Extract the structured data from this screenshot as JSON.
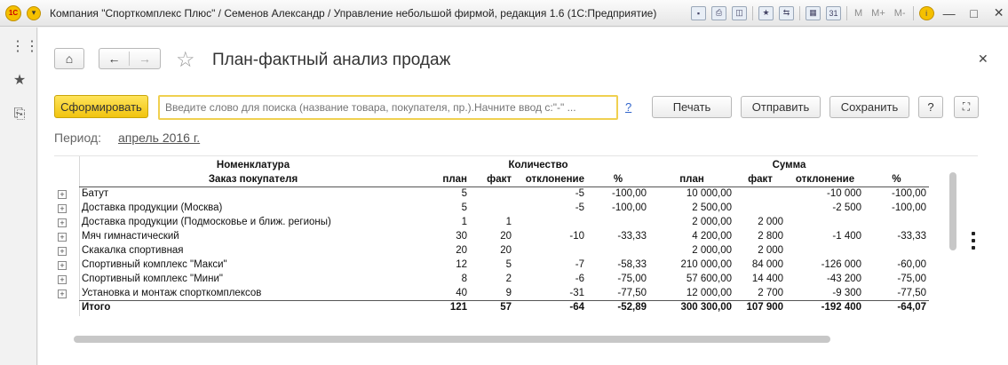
{
  "window": {
    "title": "Компания \"Спорткомплекс Плюс\" / Семенов Александр / Управление небольшой фирмой, редакция 1.6  (1С:Предприятие)",
    "toolbar_m": [
      "M",
      "M+",
      "M-"
    ]
  },
  "form": {
    "title": "План-фактный анализ продаж",
    "generate_label": "Сформировать",
    "search_placeholder": "Введите слово для поиска (название товара, покупателя, пр.).Начните ввод с:\"-\" ...",
    "help_link": "?",
    "print_label": "Печать",
    "send_label": "Отправить",
    "save_label": "Сохранить",
    "help_label": "?",
    "period_label": "Период:",
    "period_value": "апрель 2016 г."
  },
  "report": {
    "header1": {
      "nomenclature": "Номенклатура",
      "quantity": "Количество",
      "sum": "Сумма"
    },
    "header2": {
      "order": "Заказ покупателя",
      "q_plan": "план",
      "q_fact": "факт",
      "q_dev": "отклонение",
      "q_pct": "%",
      "s_plan": "план",
      "s_fact": "факт",
      "s_dev": "отклонение",
      "s_pct": "%"
    },
    "rows": [
      {
        "name": "Батут",
        "q_plan": "5",
        "q_fact": "",
        "q_dev": "-5",
        "q_pct": "-100,00",
        "s_plan": "10 000,00",
        "s_fact": "",
        "s_dev": "-10 000",
        "s_pct": "-100,00"
      },
      {
        "name": "Доставка продукции (Москва)",
        "q_plan": "5",
        "q_fact": "",
        "q_dev": "-5",
        "q_pct": "-100,00",
        "s_plan": "2 500,00",
        "s_fact": "",
        "s_dev": "-2 500",
        "s_pct": "-100,00"
      },
      {
        "name": "Доставка продукции (Подмосковье и ближ. регионы)",
        "q_plan": "1",
        "q_fact": "1",
        "q_dev": "",
        "q_pct": "",
        "s_plan": "2 000,00",
        "s_fact": "2 000",
        "s_dev": "",
        "s_pct": ""
      },
      {
        "name": "Мяч гимнастический",
        "q_plan": "30",
        "q_fact": "20",
        "q_dev": "-10",
        "q_pct": "-33,33",
        "s_plan": "4 200,00",
        "s_fact": "2 800",
        "s_dev": "-1 400",
        "s_pct": "-33,33"
      },
      {
        "name": "Скакалка спортивная",
        "q_plan": "20",
        "q_fact": "20",
        "q_dev": "",
        "q_pct": "",
        "s_plan": "2 000,00",
        "s_fact": "2 000",
        "s_dev": "",
        "s_pct": ""
      },
      {
        "name": "Спортивный комплекс \"Макси\"",
        "q_plan": "12",
        "q_fact": "5",
        "q_dev": "-7",
        "q_pct": "-58,33",
        "s_plan": "210 000,00",
        "s_fact": "84 000",
        "s_dev": "-126 000",
        "s_pct": "-60,00"
      },
      {
        "name": "Спортивный комплекс \"Мини\"",
        "q_plan": "8",
        "q_fact": "2",
        "q_dev": "-6",
        "q_pct": "-75,00",
        "s_plan": "57 600,00",
        "s_fact": "14 400",
        "s_dev": "-43 200",
        "s_pct": "-75,00"
      },
      {
        "name": "Установка и монтаж спорткомплексов",
        "q_plan": "40",
        "q_fact": "9",
        "q_dev": "-31",
        "q_pct": "-77,50",
        "s_plan": "12 000,00",
        "s_fact": "2 700",
        "s_dev": "-9 300",
        "s_pct": "-77,50"
      }
    ],
    "total": {
      "name": "Итого",
      "q_plan": "121",
      "q_fact": "57",
      "q_dev": "-64",
      "q_pct": "-52,89",
      "s_plan": "300 300,00",
      "s_fact": "107 900",
      "s_dev": "-192 400",
      "s_pct": "-64,07"
    }
  }
}
